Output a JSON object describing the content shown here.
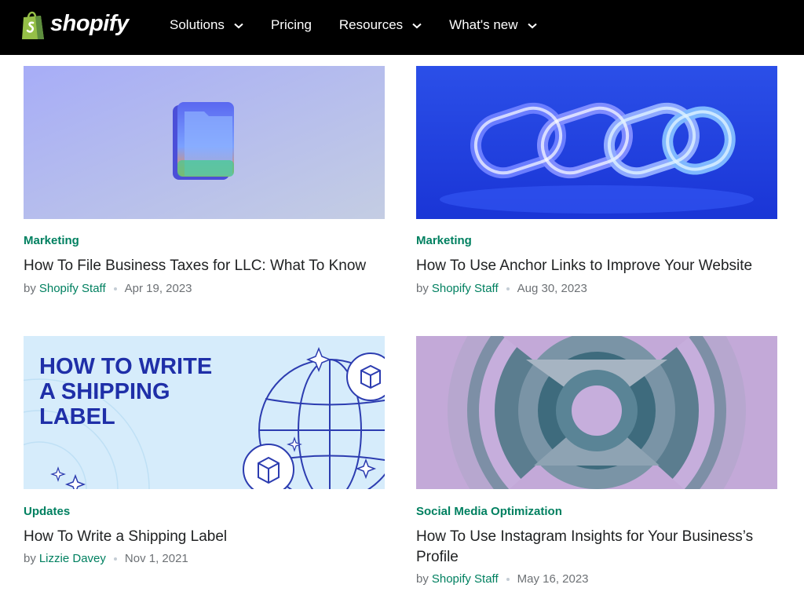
{
  "header": {
    "logo_text": "shopify",
    "nav": [
      {
        "label": "Solutions",
        "has_dropdown": true
      },
      {
        "label": "Pricing",
        "has_dropdown": false
      },
      {
        "label": "Resources",
        "has_dropdown": true
      },
      {
        "label": "What's new",
        "has_dropdown": true
      }
    ]
  },
  "articles": [
    {
      "category": "Marketing",
      "title": "How To File Business Taxes for LLC: What To Know",
      "by": "by",
      "author": "Shopify Staff",
      "date": "Apr 19, 2023",
      "image_icon": "folder-icon"
    },
    {
      "category": "Marketing",
      "title": "How To Use Anchor Links to Improve Your Website",
      "by": "by",
      "author": "Shopify Staff",
      "date": "Aug 30, 2023",
      "image_icon": "chain-link-icon"
    },
    {
      "category": "Updates",
      "title": "How To Write a Shipping Label",
      "by": "by",
      "author": "Lizzie Davey",
      "date": "Nov 1, 2021",
      "image_text": [
        "HOW TO WRITE",
        "A SHIPPING",
        "LABEL"
      ]
    },
    {
      "category": "Social Media Optimization",
      "title": "How To Use Instagram Insights for Your Business’s Profile",
      "by": "by",
      "author": "Shopify Staff",
      "date": "May 16, 2023",
      "image_icon": "concentric-rings-graphic"
    }
  ],
  "colors": {
    "header_bg": "#000000",
    "accent_green": "#008060",
    "logo_green": "#95bf47",
    "meta_gray": "#6d7175"
  }
}
